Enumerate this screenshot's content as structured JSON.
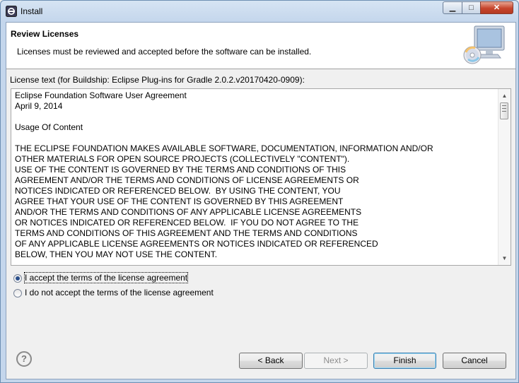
{
  "window": {
    "title": "Install"
  },
  "banner": {
    "title": "Review Licenses",
    "description": "Licenses must be reviewed and accepted before the software can be installed."
  },
  "license": {
    "label": "License text (for Buildship: Eclipse Plug-ins for Gradle 2.0.2.v20170420-0909):",
    "lines": [
      "Eclipse Foundation Software User Agreement",
      "April 9, 2014",
      "",
      "Usage Of Content",
      "",
      "THE ECLIPSE FOUNDATION MAKES AVAILABLE SOFTWARE, DOCUMENTATION, INFORMATION AND/OR",
      "OTHER MATERIALS FOR OPEN SOURCE PROJECTS (COLLECTIVELY \"CONTENT\").",
      "USE OF THE CONTENT IS GOVERNED BY THE TERMS AND CONDITIONS OF THIS",
      "AGREEMENT AND/OR THE TERMS AND CONDITIONS OF LICENSE AGREEMENTS OR",
      "NOTICES INDICATED OR REFERENCED BELOW.  BY USING THE CONTENT, YOU",
      "AGREE THAT YOUR USE OF THE CONTENT IS GOVERNED BY THIS AGREEMENT",
      "AND/OR THE TERMS AND CONDITIONS OF ANY APPLICABLE LICENSE AGREEMENTS",
      "OR NOTICES INDICATED OR REFERENCED BELOW.  IF YOU DO NOT AGREE TO THE",
      "TERMS AND CONDITIONS OF THIS AGREEMENT AND THE TERMS AND CONDITIONS",
      "OF ANY APPLICABLE LICENSE AGREEMENTS OR NOTICES INDICATED OR REFERENCED",
      "BELOW, THEN YOU MAY NOT USE THE CONTENT."
    ]
  },
  "options": {
    "accept": "I accept the terms of the license agreement",
    "decline": "I do not accept the terms of the license agreement",
    "selected": "accept"
  },
  "buttons": {
    "back": "< Back",
    "next": "Next >",
    "finish": "Finish",
    "cancel": "Cancel"
  },
  "icons": {
    "app": "eclipse-icon",
    "banner": "computer-cd-icon",
    "help": "help-icon"
  }
}
